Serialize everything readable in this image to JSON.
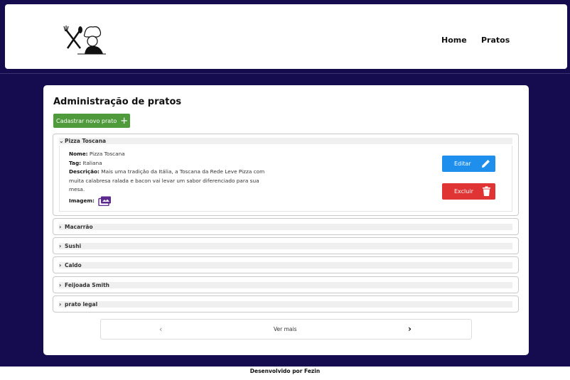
{
  "nav": {
    "home": "Home",
    "pratos": "Pratos"
  },
  "page": {
    "title": "Administração de pratos",
    "new_button": "Cadastrar novo prato",
    "new_button_icon": "+"
  },
  "dishes": [
    {
      "title": "Pizza Toscana",
      "expanded": true,
      "labels": {
        "name": "Nome:",
        "tag": "Tag:",
        "desc": "Descrição:",
        "image": "Imagem:"
      },
      "name": "Pizza Toscana",
      "tag": "Italiana",
      "description": "Mais uma tradição da Itália, a Toscana da Rede Leve Pizza com muita calabresa ralada e bacon vai levar um sabor diferenciado para sua mesa.",
      "edit_label": "Editar",
      "delete_label": "Excluir"
    },
    {
      "title": "Macarrão",
      "expanded": false
    },
    {
      "title": "Sushi",
      "expanded": false
    },
    {
      "title": "Caldo",
      "expanded": false
    },
    {
      "title": "Feijoada Smith",
      "expanded": false
    },
    {
      "title": "prato legal",
      "expanded": false
    }
  ],
  "pagination": {
    "prev": "‹",
    "more": "Ver mais",
    "next": "›"
  },
  "footer": "Desenvolvido por Fezin",
  "colors": {
    "background": "#150b4f",
    "new_button": "#4f9a3b",
    "edit": "#1e8fec",
    "delete": "#e03434",
    "image_icon": "#5b2a8c"
  }
}
